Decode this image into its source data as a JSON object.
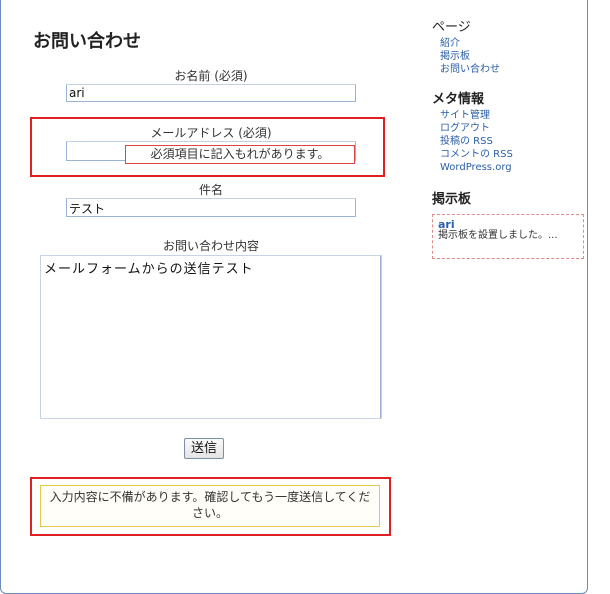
{
  "contact_form": {
    "title": "お問い合わせ",
    "name_label": "お名前 (必須)",
    "name_value": "ari",
    "email_label": "メールアドレス (必須)",
    "email_value": "",
    "email_error": "必須項目に記入もれがあります。",
    "subject_label": "件名",
    "subject_value": "テスト",
    "message_label": "お問い合わせ内容",
    "message_value": "メールフォームからの送信テスト",
    "submit_label": "送信",
    "validation_message": "入力内容に不備があります。確認してもう一度送信してください。"
  },
  "sidebar": {
    "pages": {
      "heading": "ページ",
      "items": [
        "紹介",
        "掲示板",
        "お問い合わせ"
      ]
    },
    "meta": {
      "heading": "メタ情報",
      "items": [
        "サイト管理",
        "ログアウト",
        "投稿の RSS",
        "コメントの RSS",
        "WordPress.org"
      ]
    },
    "bbs": {
      "heading": "掲示板",
      "user": "ari",
      "message": "掲示板を設置しました。..."
    }
  },
  "colors": {
    "highlight_red": "#e02020",
    "warning_border": "#e6c84a",
    "link": "#2b5ea8"
  }
}
